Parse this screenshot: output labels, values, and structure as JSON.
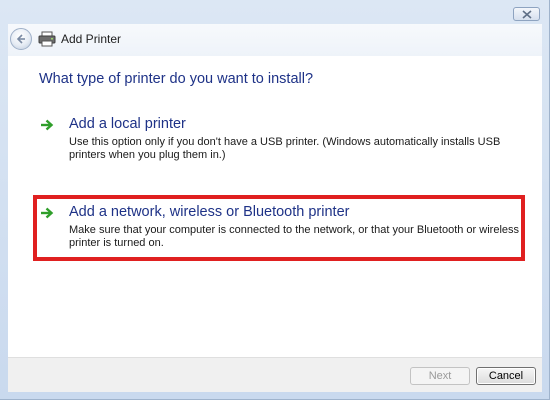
{
  "window": {
    "title": "Add Printer",
    "close_icon": "close-icon"
  },
  "main": {
    "question": "What type of printer do you want to install?",
    "options": [
      {
        "title": "Add a local printer",
        "description": "Use this option only if you don't have a USB printer. (Windows automatically installs USB printers when you plug them in.)",
        "icon": "green-arrow-icon"
      },
      {
        "title": "Add a network, wireless or Bluetooth printer",
        "description": "Make sure that your computer is connected to the network, or that your Bluetooth or wireless printer is turned on.",
        "icon": "green-arrow-icon"
      }
    ],
    "highlight_color": "#e02020"
  },
  "footer": {
    "next_label": "Next",
    "cancel_label": "Cancel"
  }
}
